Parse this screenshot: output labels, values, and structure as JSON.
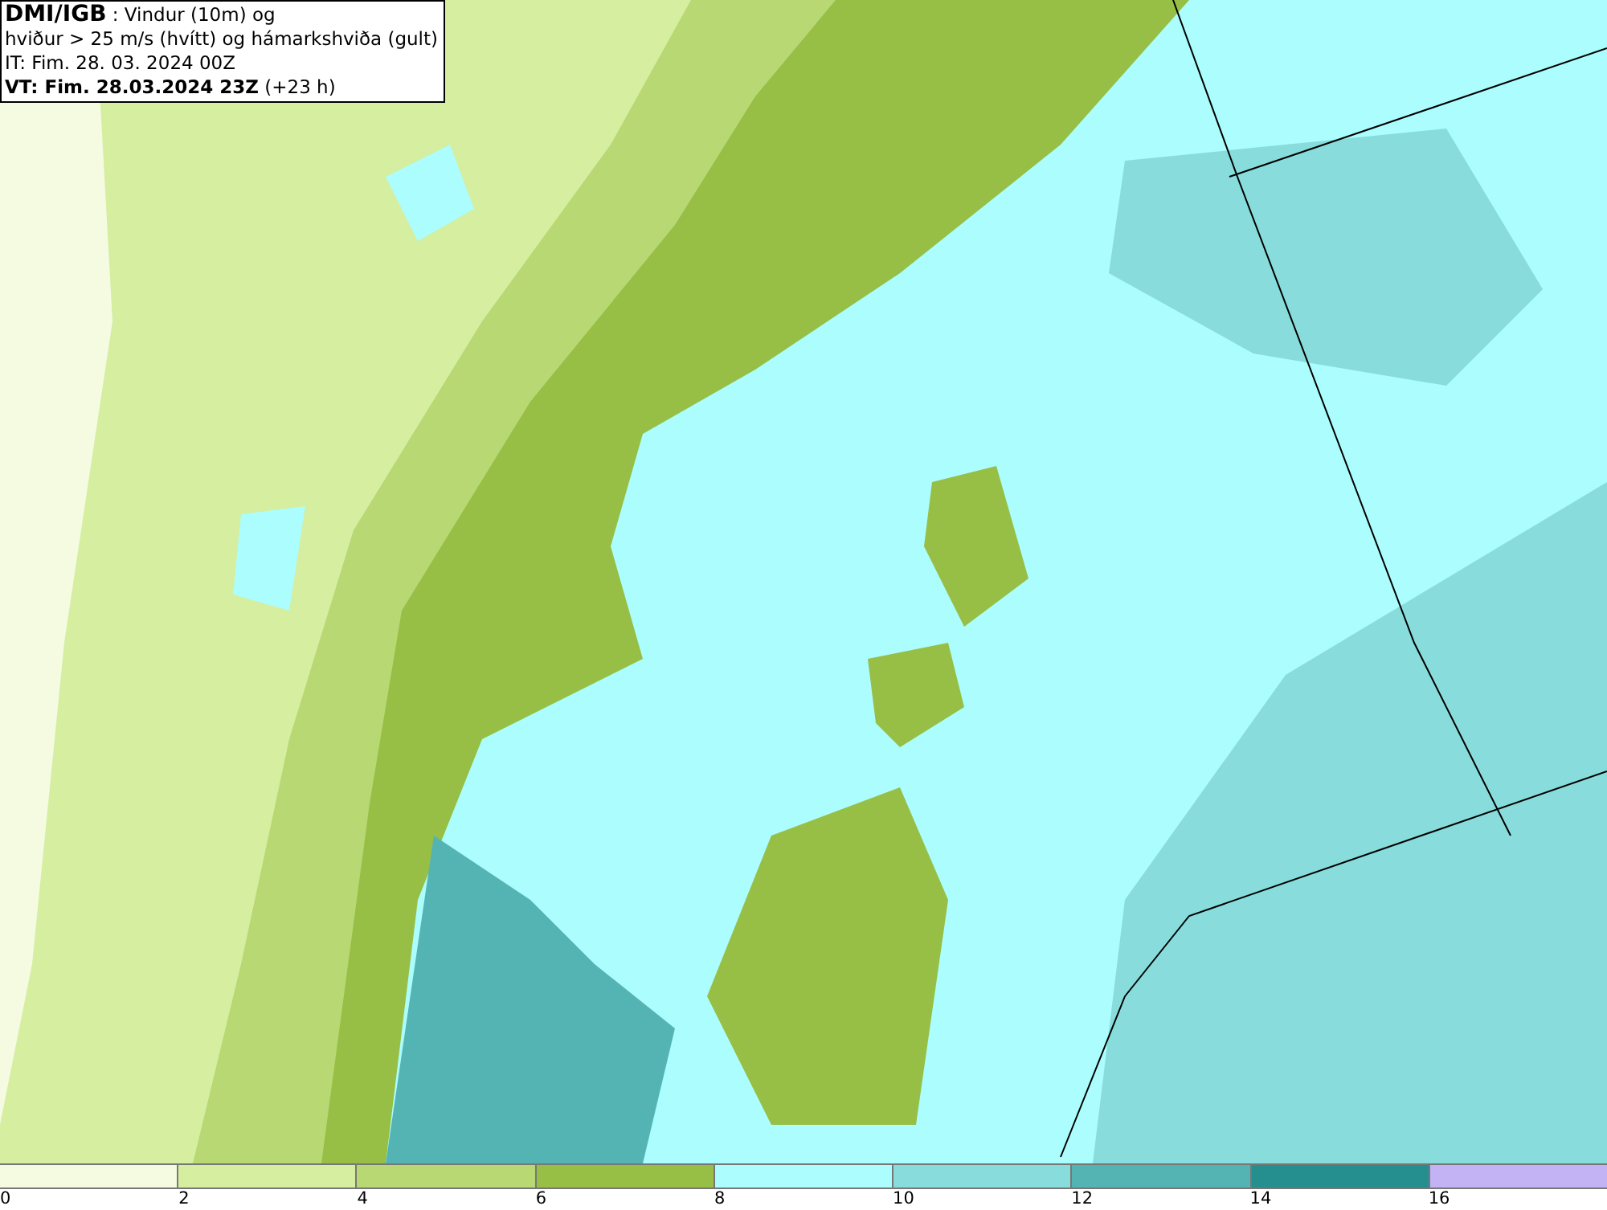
{
  "header": {
    "lines": [
      "**DMI/IGB** : Vindur (10m) og",
      "hviður > 25 m/s (hvítt) og hámarkshviða (gult)",
      "IT: Fim. 28. 03. 2024 00Z",
      "**VT: Fim. 28.03.2024 23Z** (+23 h)"
    ]
  },
  "legend": {
    "segments": [
      {
        "label": "0",
        "color": "#f4fbe0"
      },
      {
        "label": "2",
        "color": "#d5eea0"
      },
      {
        "label": "4",
        "color": "#b7d873"
      },
      {
        "label": "6",
        "color": "#97bf45"
      },
      {
        "label": "8",
        "color": "#acfdfd"
      },
      {
        "label": "10",
        "color": "#88dcdc"
      },
      {
        "label": "12",
        "color": "#54b4b4"
      },
      {
        "label": "14",
        "color": "#258f8f"
      },
      {
        "label": "16",
        "color": "#c3b3f5"
      }
    ]
  }
}
